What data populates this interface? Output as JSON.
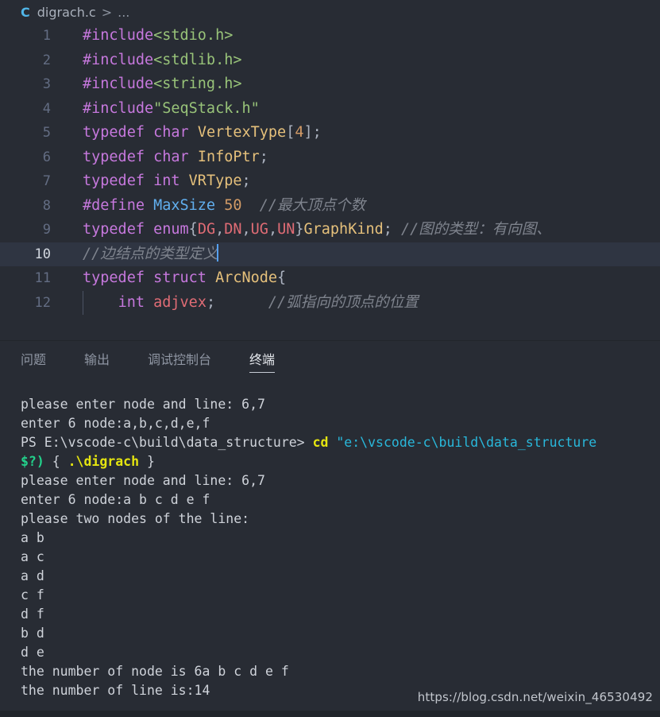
{
  "window": {
    "background": "#282c34",
    "accent": "#61afef"
  },
  "breadcrumb": {
    "lang_icon": "C",
    "file": "digrach.c",
    "separator": ">",
    "more": "..."
  },
  "editor": {
    "lines": [
      {
        "number": "1",
        "tokens": [
          {
            "text": "#include",
            "cls": "t-pre"
          },
          {
            "text": "<stdio.h>",
            "cls": "t-str"
          }
        ]
      },
      {
        "number": "2",
        "tokens": [
          {
            "text": "#include",
            "cls": "t-pre"
          },
          {
            "text": "<stdlib.h>",
            "cls": "t-str"
          }
        ]
      },
      {
        "number": "3",
        "tokens": [
          {
            "text": "#include",
            "cls": "t-pre"
          },
          {
            "text": "<string.h>",
            "cls": "t-str"
          }
        ]
      },
      {
        "number": "4",
        "tokens": [
          {
            "text": "#include",
            "cls": "t-pre"
          },
          {
            "text": "\"SeqStack.h\"",
            "cls": "t-str"
          }
        ]
      },
      {
        "number": "5",
        "tokens": [
          {
            "text": "typedef",
            "cls": "t-kw"
          },
          {
            "text": " ",
            "cls": "t-punc"
          },
          {
            "text": "char",
            "cls": "t-kw"
          },
          {
            "text": " ",
            "cls": "t-punc"
          },
          {
            "text": "VertexType",
            "cls": "t-type"
          },
          {
            "text": "[",
            "cls": "t-punc"
          },
          {
            "text": "4",
            "cls": "t-num"
          },
          {
            "text": "];",
            "cls": "t-punc"
          }
        ]
      },
      {
        "number": "6",
        "tokens": [
          {
            "text": "typedef",
            "cls": "t-kw"
          },
          {
            "text": " ",
            "cls": "t-punc"
          },
          {
            "text": "char",
            "cls": "t-kw"
          },
          {
            "text": " ",
            "cls": "t-punc"
          },
          {
            "text": "InfoPtr",
            "cls": "t-type"
          },
          {
            "text": ";",
            "cls": "t-punc"
          }
        ]
      },
      {
        "number": "7",
        "tokens": [
          {
            "text": "typedef",
            "cls": "t-kw"
          },
          {
            "text": " ",
            "cls": "t-punc"
          },
          {
            "text": "int",
            "cls": "t-kw"
          },
          {
            "text": " ",
            "cls": "t-punc"
          },
          {
            "text": "VRType",
            "cls": "t-type"
          },
          {
            "text": ";",
            "cls": "t-punc"
          }
        ]
      },
      {
        "number": "8",
        "tokens": [
          {
            "text": "#define",
            "cls": "t-pre"
          },
          {
            "text": " ",
            "cls": "t-punc"
          },
          {
            "text": "MaxSize",
            "cls": "t-def"
          },
          {
            "text": " ",
            "cls": "t-punc"
          },
          {
            "text": "50",
            "cls": "t-num"
          },
          {
            "text": "  ",
            "cls": "t-punc"
          },
          {
            "text": "//最大顶点个数",
            "cls": "t-cmt"
          }
        ]
      },
      {
        "number": "9",
        "tokens": [
          {
            "text": "typedef",
            "cls": "t-kw"
          },
          {
            "text": " ",
            "cls": "t-punc"
          },
          {
            "text": "enum",
            "cls": "t-kw"
          },
          {
            "text": "{",
            "cls": "t-punc"
          },
          {
            "text": "DG",
            "cls": "t-enum"
          },
          {
            "text": ",",
            "cls": "t-punc"
          },
          {
            "text": "DN",
            "cls": "t-enum"
          },
          {
            "text": ",",
            "cls": "t-punc"
          },
          {
            "text": "UG",
            "cls": "t-enum"
          },
          {
            "text": ",",
            "cls": "t-punc"
          },
          {
            "text": "UN",
            "cls": "t-enum"
          },
          {
            "text": "}",
            "cls": "t-punc"
          },
          {
            "text": "GraphKind",
            "cls": "t-type"
          },
          {
            "text": "; ",
            "cls": "t-punc"
          },
          {
            "text": "//图的类型：有向图、",
            "cls": "t-cmt"
          }
        ]
      },
      {
        "number": "10",
        "active": true,
        "cursor": true,
        "tokens": [
          {
            "text": "//边结点的类型定义",
            "cls": "t-cmt"
          }
        ]
      },
      {
        "number": "11",
        "tokens": [
          {
            "text": "typedef",
            "cls": "t-kw"
          },
          {
            "text": " ",
            "cls": "t-punc"
          },
          {
            "text": "struct",
            "cls": "t-kw"
          },
          {
            "text": " ",
            "cls": "t-punc"
          },
          {
            "text": "ArcNode",
            "cls": "t-type"
          },
          {
            "text": "{",
            "cls": "t-punc"
          }
        ]
      },
      {
        "number": "12",
        "indent_guide": true,
        "tokens": [
          {
            "text": "    ",
            "cls": "t-punc"
          },
          {
            "text": "int",
            "cls": "t-kw"
          },
          {
            "text": " ",
            "cls": "t-punc"
          },
          {
            "text": "adjvex",
            "cls": "t-var"
          },
          {
            "text": ";",
            "cls": "t-punc"
          },
          {
            "text": "      ",
            "cls": "t-punc"
          },
          {
            "text": "//弧指向的顶点的位置",
            "cls": "t-cmt"
          }
        ]
      }
    ]
  },
  "panel": {
    "tabs": [
      {
        "label": "问题",
        "active": false
      },
      {
        "label": "输出",
        "active": false
      },
      {
        "label": "调试控制台",
        "active": false
      },
      {
        "label": "终端",
        "active": true
      }
    ]
  },
  "terminal": {
    "lines": [
      {
        "segments": [
          {
            "text": "please enter node and line: 6,7",
            "cls": "c-white"
          }
        ]
      },
      {
        "segments": [
          {
            "text": "enter 6 node:a,b,c,d,e,f",
            "cls": "c-white"
          }
        ]
      },
      {
        "segments": [
          {
            "text": "PS E:\\vscode-c\\build\\data_structure> ",
            "cls": "c-white"
          },
          {
            "text": "cd",
            "cls": "c-yellow"
          },
          {
            "text": " ",
            "cls": "c-white"
          },
          {
            "text": "\"e:\\vscode-c\\build\\data_structure",
            "cls": "c-cyan"
          }
        ]
      },
      {
        "segments": [
          {
            "text": "$?)",
            "cls": "c-green"
          },
          {
            "text": " { ",
            "cls": "c-white"
          },
          {
            "text": ".\\digrach",
            "cls": "c-yellow"
          },
          {
            "text": " }",
            "cls": "c-white"
          }
        ]
      },
      {
        "segments": [
          {
            "text": "please enter node and line: 6,7",
            "cls": "c-white"
          }
        ]
      },
      {
        "segments": [
          {
            "text": "enter 6 node:a b c d e f",
            "cls": "c-white"
          }
        ]
      },
      {
        "segments": [
          {
            "text": "please two nodes of the line:",
            "cls": "c-white"
          }
        ]
      },
      {
        "segments": [
          {
            "text": "a b",
            "cls": "c-white"
          }
        ]
      },
      {
        "segments": [
          {
            "text": "a c",
            "cls": "c-white"
          }
        ]
      },
      {
        "segments": [
          {
            "text": "a d",
            "cls": "c-white"
          }
        ]
      },
      {
        "segments": [
          {
            "text": "c f",
            "cls": "c-white"
          }
        ]
      },
      {
        "segments": [
          {
            "text": "d f",
            "cls": "c-white"
          }
        ]
      },
      {
        "segments": [
          {
            "text": "b d",
            "cls": "c-white"
          }
        ]
      },
      {
        "segments": [
          {
            "text": "d e",
            "cls": "c-white"
          }
        ]
      },
      {
        "segments": [
          {
            "text": "the number of node is 6a b c d e f",
            "cls": "c-white"
          }
        ]
      },
      {
        "segments": [
          {
            "text": "the number of line is:14",
            "cls": "c-white"
          }
        ]
      }
    ]
  },
  "watermark": {
    "text": "https://blog.csdn.net/weixin_46530492"
  }
}
